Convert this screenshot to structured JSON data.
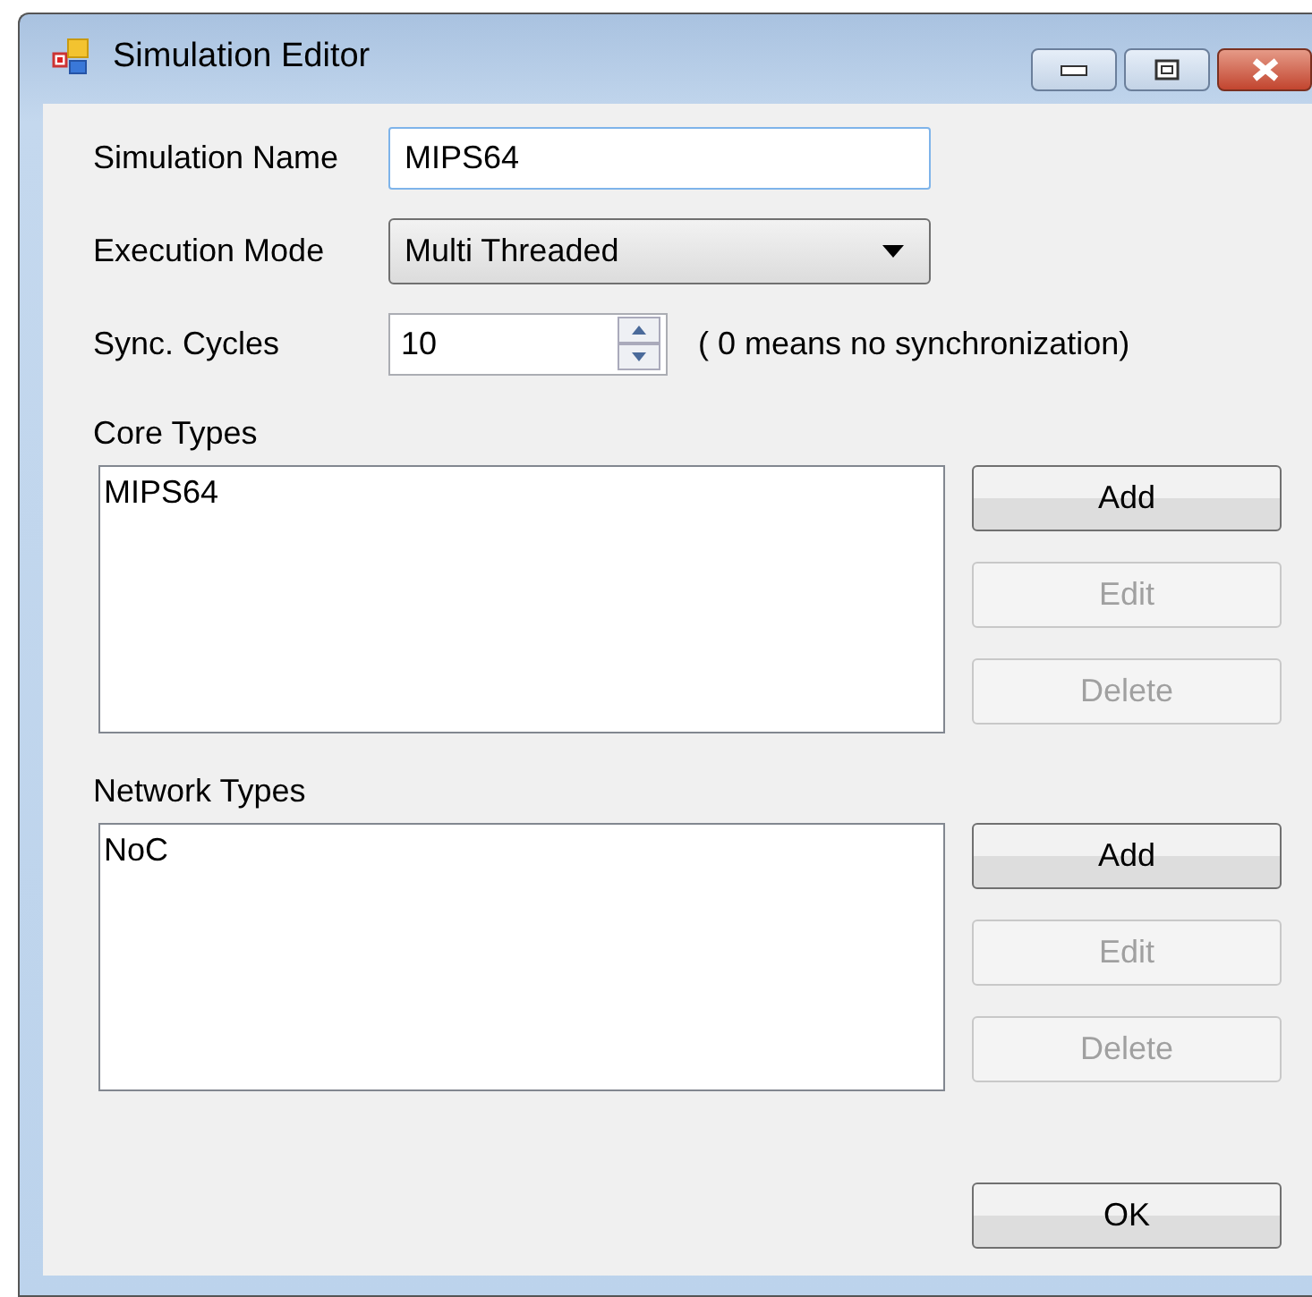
{
  "window": {
    "title": "Simulation Editor"
  },
  "fields": [
    {
      "kind": "text",
      "label": "Simulation Name",
      "value": "MIPS64"
    },
    {
      "kind": "dropdown",
      "label": "Execution Mode",
      "value": "Multi Threaded"
    },
    {
      "kind": "spinner",
      "label": "Sync. Cycles",
      "value": "10",
      "note": "( 0 means no synchronization)"
    }
  ],
  "sections": [
    {
      "label": "Core Types",
      "items": [
        "MIPS64"
      ],
      "buttons": [
        {
          "label": "Add",
          "disabled": false
        },
        {
          "label": "Edit",
          "disabled": true
        },
        {
          "label": "Delete",
          "disabled": true
        }
      ]
    },
    {
      "label": "Network Types",
      "items": [
        "NoC"
      ],
      "buttons": [
        {
          "label": "Add",
          "disabled": false
        },
        {
          "label": "Edit",
          "disabled": true
        },
        {
          "label": "Delete",
          "disabled": true
        }
      ]
    }
  ],
  "ok_button": {
    "label": "OK",
    "disabled": false
  }
}
